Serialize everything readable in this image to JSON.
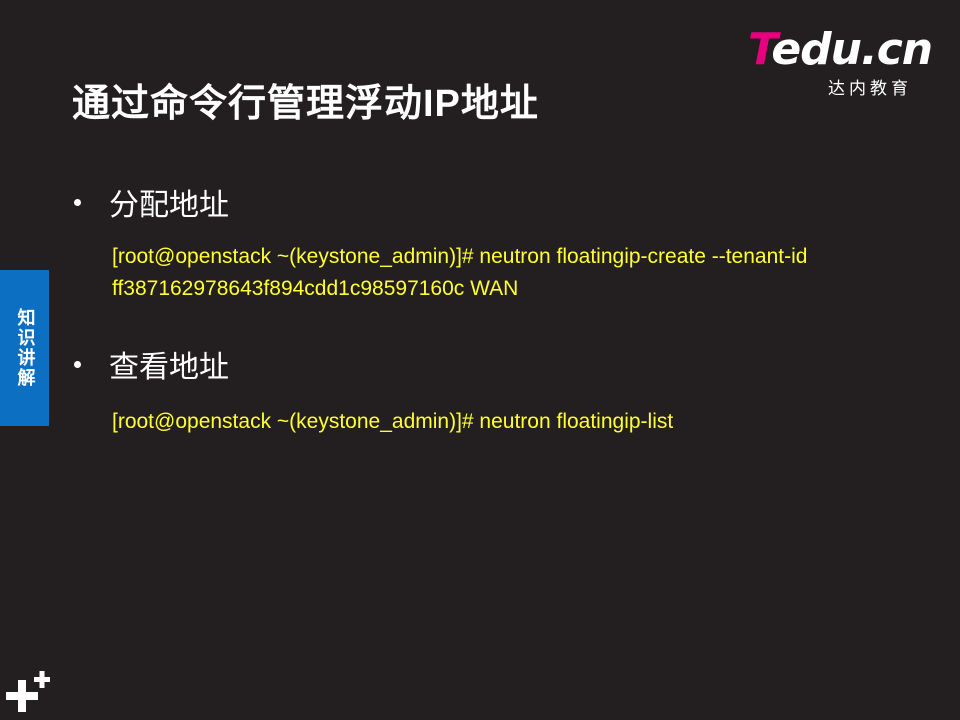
{
  "slide": {
    "title": "通过命令行管理浮动IP地址",
    "logo": {
      "brand_t": "T",
      "brand_rest": "edu.cn",
      "subtitle": "达内教育"
    },
    "side_tab": {
      "label": "知识讲解",
      "color": "#0d6fc2"
    },
    "sections": [
      {
        "bullet": "分配地址",
        "code_lines": [
          "[root@openstack ~(keystone_admin)]# neutron floatingip-create --tenant-id",
          "ff387162978643f894cdd1c98597160c WAN"
        ]
      },
      {
        "bullet": "查看地址",
        "code_lines": [
          "[root@openstack ~(keystone_admin)]# neutron floatingip-list"
        ]
      }
    ],
    "colors": {
      "background": "#231f20",
      "code_text": "#ffff33",
      "brand_accent": "#e6007e"
    },
    "icons": [
      "plus-plus-icon"
    ]
  }
}
